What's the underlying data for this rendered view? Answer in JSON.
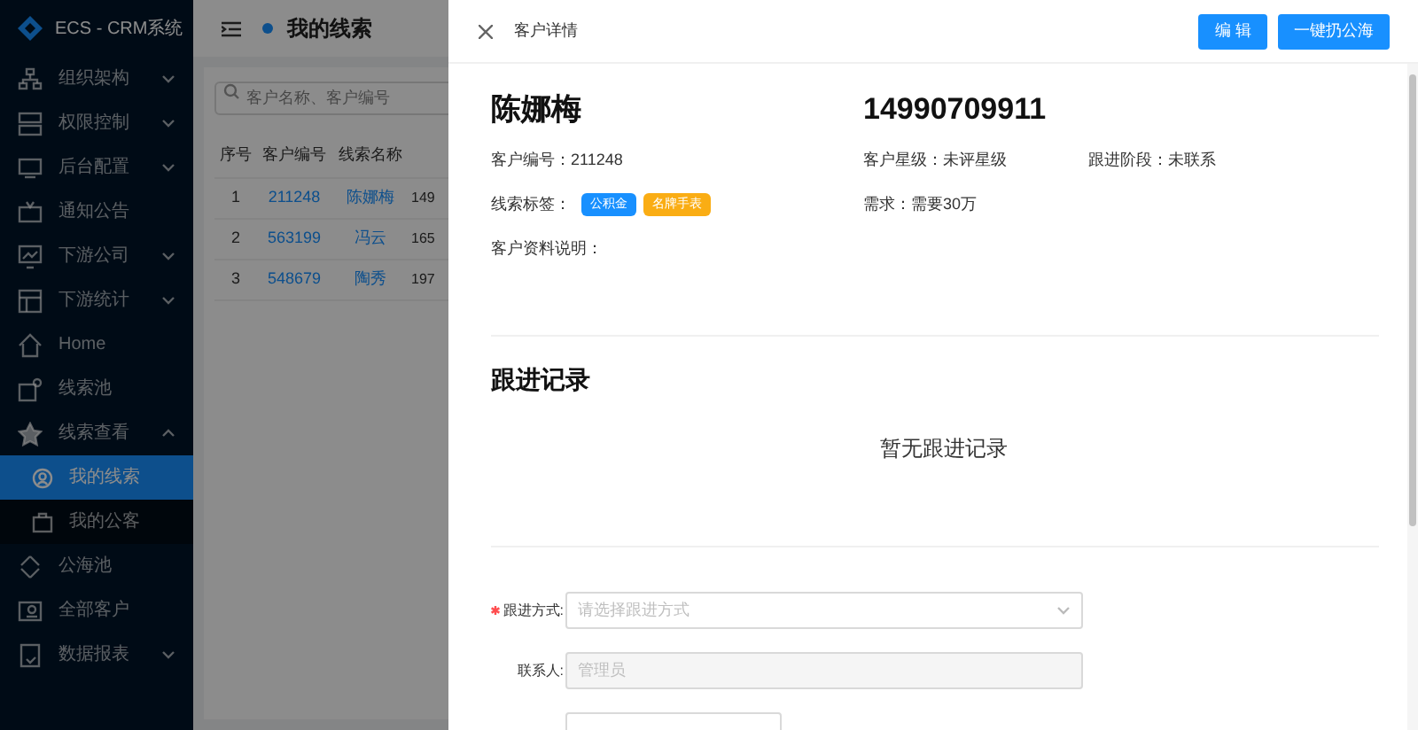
{
  "app": {
    "title": "ECS - CRM系统"
  },
  "sidebar": {
    "items": [
      {
        "label": "组织架构",
        "kind": "submenu",
        "expanded": false
      },
      {
        "label": "权限控制",
        "kind": "submenu",
        "expanded": false
      },
      {
        "label": "后台配置",
        "kind": "submenu",
        "expanded": false
      },
      {
        "label": "通知公告",
        "kind": "link"
      },
      {
        "label": "下游公司",
        "kind": "submenu",
        "expanded": false
      },
      {
        "label": "下游统计",
        "kind": "submenu",
        "expanded": false
      },
      {
        "label": "Home",
        "kind": "link"
      },
      {
        "label": "线索池",
        "kind": "link"
      },
      {
        "label": "线索查看",
        "kind": "submenu",
        "expanded": true,
        "children": [
          {
            "label": "我的线索",
            "selected": true
          },
          {
            "label": "我的公客",
            "selected": false
          }
        ]
      },
      {
        "label": "公海池",
        "kind": "link"
      },
      {
        "label": "全部客户",
        "kind": "link"
      },
      {
        "label": "数据报表",
        "kind": "submenu",
        "expanded": false
      }
    ]
  },
  "page": {
    "title": "我的线索",
    "search": {
      "placeholder": "客户名称、客户编号"
    },
    "table": {
      "columns": [
        "序号",
        "客户编号",
        "线索名称"
      ],
      "rows": [
        [
          "1",
          "211248",
          "陈娜梅",
          "149"
        ],
        [
          "2",
          "563199",
          "冯云",
          "165"
        ],
        [
          "3",
          "548679",
          "陶秀",
          "197"
        ]
      ]
    }
  },
  "drawer": {
    "title": "客户详情",
    "buttons": [
      "编 辑",
      "一键扔公海"
    ],
    "name": "陈娜梅",
    "phone": "14990709911",
    "customer_no": {
      "label": "客户编号：",
      "value": "211248"
    },
    "star_level": {
      "label": "客户星级：",
      "value": "未评星级"
    },
    "stage": {
      "label": "跟进阶段：",
      "value": "未联系"
    },
    "tags": {
      "label": "线索标签：",
      "items": [
        {
          "text": "公积金",
          "color": "#1890ff"
        },
        {
          "text": "名牌手表",
          "color": "#faad14"
        }
      ]
    },
    "demand": {
      "label": "需求：",
      "value": "需要30万"
    },
    "note": {
      "label": "客户资料说明："
    },
    "records": {
      "title": "跟进记录",
      "empty": "暂无跟进记录"
    },
    "form": [
      {
        "kind": "select",
        "label": "跟进方式:",
        "required": true,
        "placeholder": "请选择跟进方式"
      },
      {
        "kind": "input",
        "label": "联系人:",
        "required": false,
        "disabled": true,
        "value": "管理员"
      },
      {
        "kind": "input"
      }
    ]
  }
}
